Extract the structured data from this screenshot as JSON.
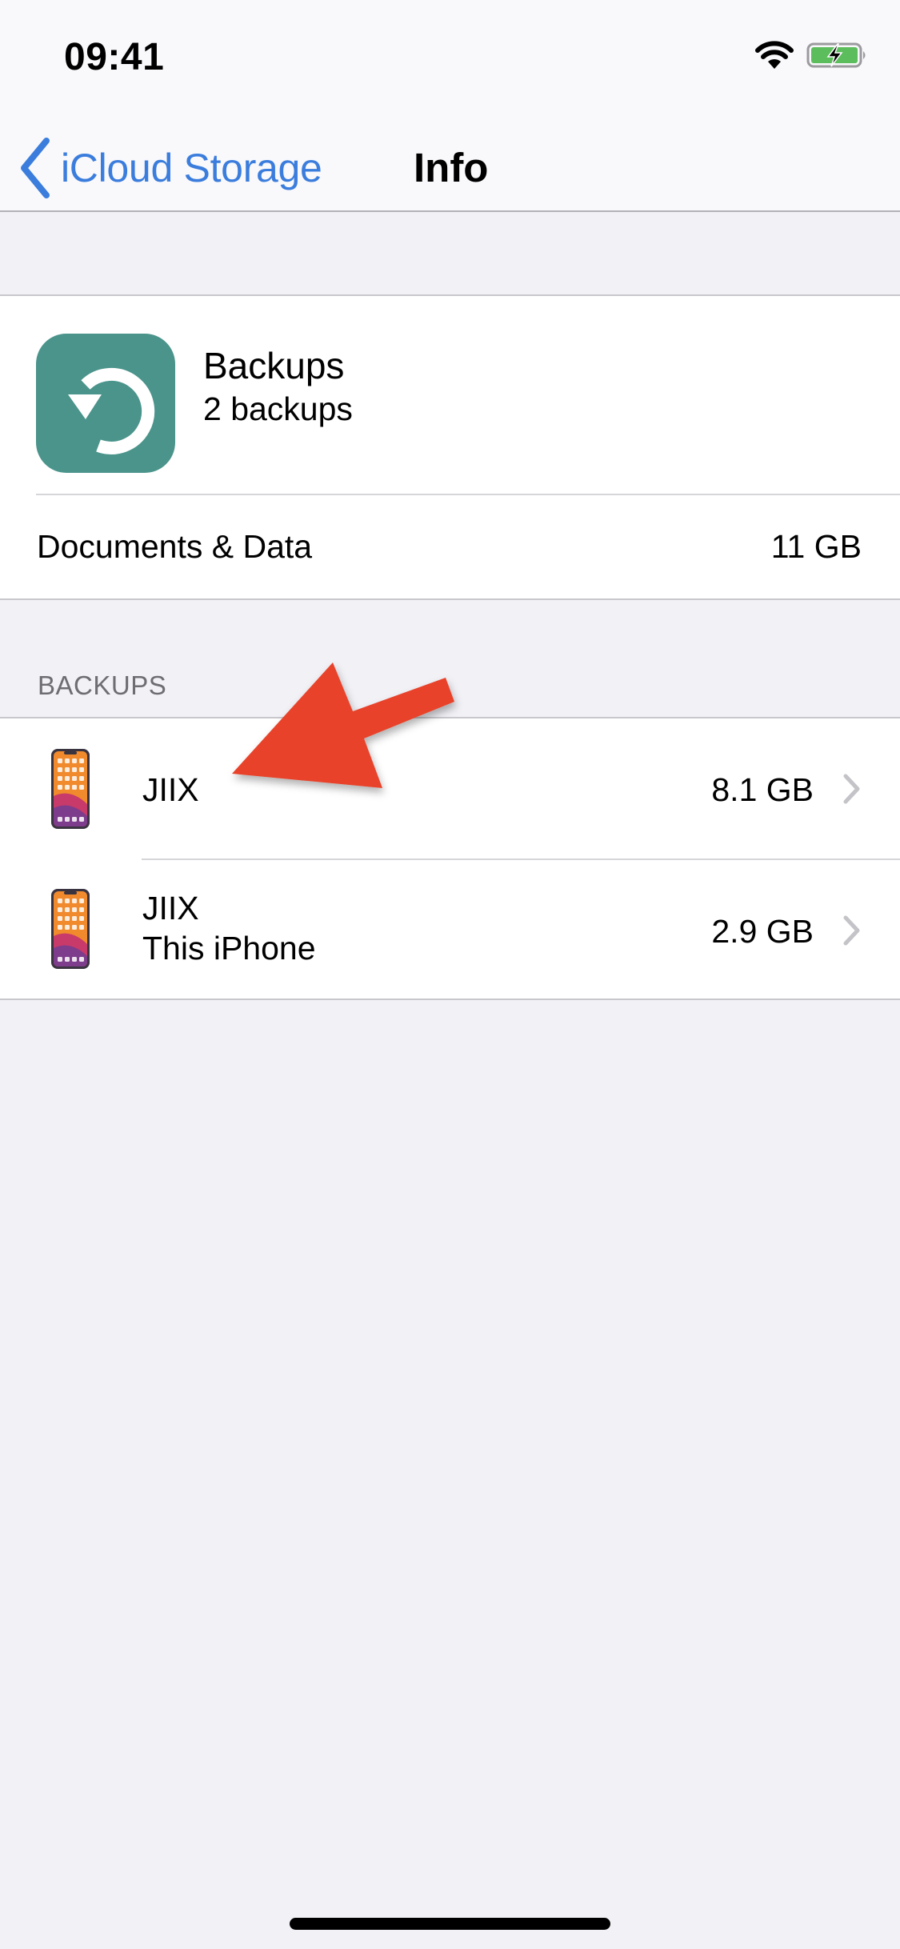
{
  "status_bar": {
    "time": "09:41",
    "wifi_icon": "wifi-icon",
    "battery_icon": "battery-charging-icon",
    "battery_color": "#5cbd5c"
  },
  "nav": {
    "back_label": "iCloud Storage",
    "title": "Info",
    "accent": "#3b7ddd"
  },
  "app_header": {
    "icon": "backup-restore-icon",
    "icon_color": "#4a948b",
    "title": "Backups",
    "subtitle": "2 backups"
  },
  "documents_row": {
    "label": "Documents & Data",
    "value": "11 GB"
  },
  "backups_section": {
    "header": "BACKUPS",
    "items": [
      {
        "name": "JIIX",
        "subtitle": "",
        "size": "8.1 GB",
        "icon": "iphone-device-icon"
      },
      {
        "name": "JIIX",
        "subtitle": "This iPhone",
        "size": "2.9 GB",
        "icon": "iphone-device-icon"
      }
    ]
  },
  "annotation": {
    "type": "red-arrow",
    "color": "#e8432a",
    "points_to": "backups_section.items.0"
  }
}
